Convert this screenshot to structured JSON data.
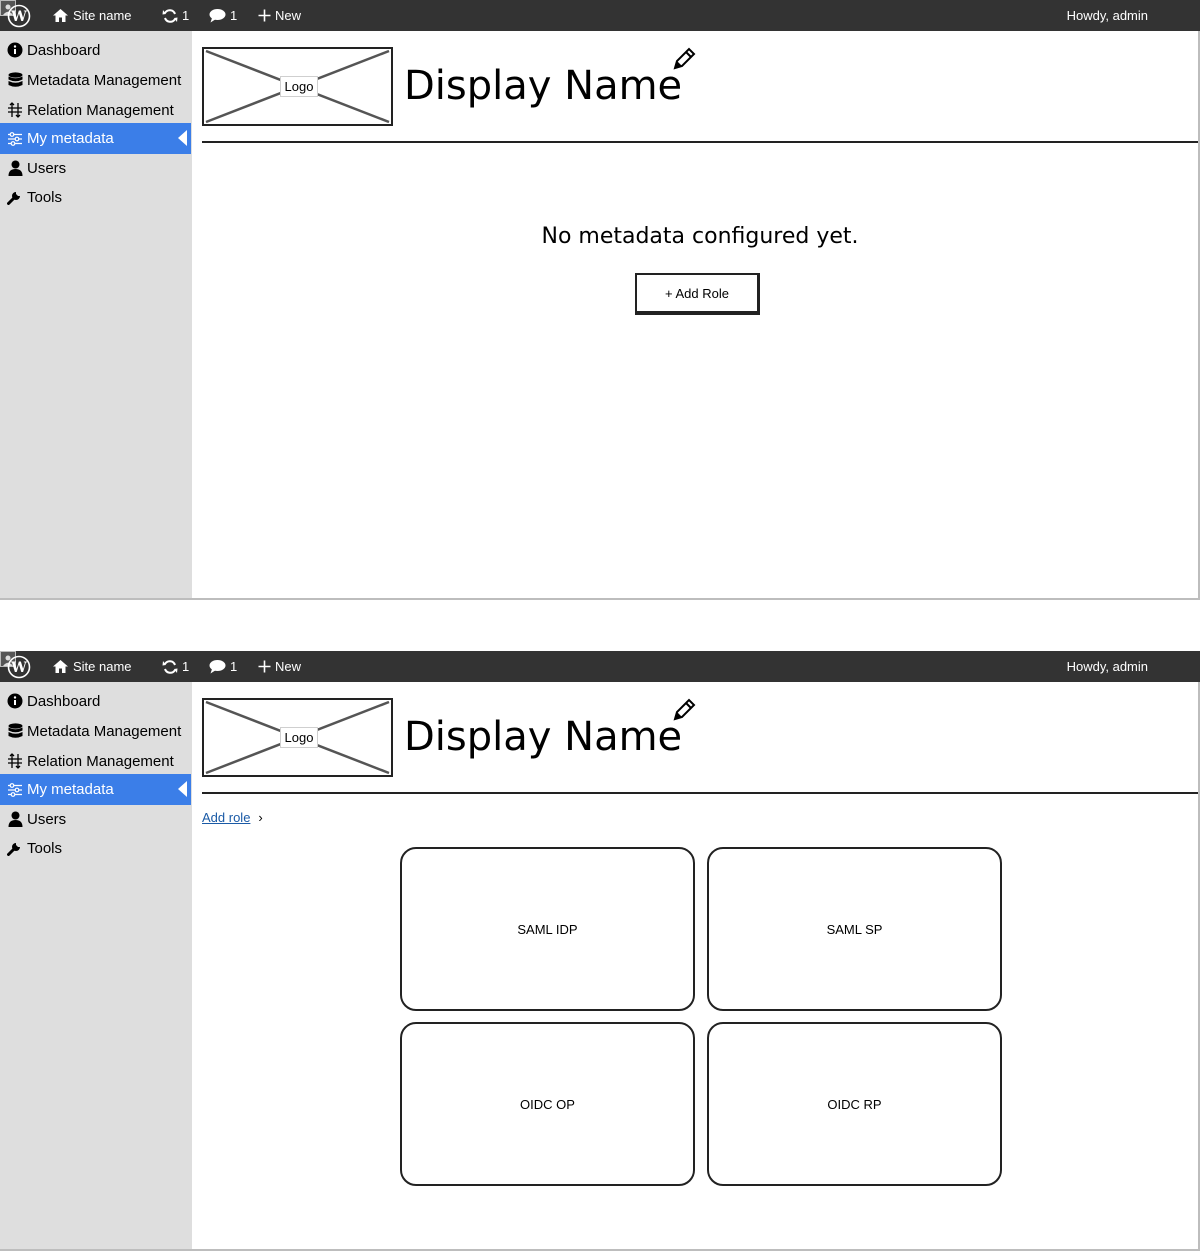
{
  "adminbar": {
    "site_name": "Site name",
    "updates_count": "1",
    "comments_count": "1",
    "new_label": "New",
    "howdy": "Howdy, admin"
  },
  "sidebar": {
    "items": [
      {
        "label": "Dashboard",
        "icon": "info-icon"
      },
      {
        "label": "Metadata Management",
        "icon": "database-icon"
      },
      {
        "label": "Relation Management",
        "icon": "arrows-icon"
      },
      {
        "label": "My metadata",
        "icon": "sliders-icon",
        "active": true
      },
      {
        "label": "Users",
        "icon": "user-icon"
      },
      {
        "label": "Tools",
        "icon": "wrench-icon"
      }
    ]
  },
  "header": {
    "logo_label": "Logo",
    "display_name": "Display Name"
  },
  "screen1": {
    "empty_message": "No metadata configured yet.",
    "add_role_button": "+ Add Role"
  },
  "screen2": {
    "breadcrumb_link": "Add role",
    "breadcrumb_separator": "›",
    "roles": [
      "SAML IDP",
      "SAML SP",
      "OIDC OP",
      "OIDC RP"
    ]
  },
  "colors": {
    "adminbar_bg": "#333333",
    "sidebar_bg": "#dedede",
    "active_menu_bg": "#3b7ee8",
    "link": "#1a5aa6"
  }
}
